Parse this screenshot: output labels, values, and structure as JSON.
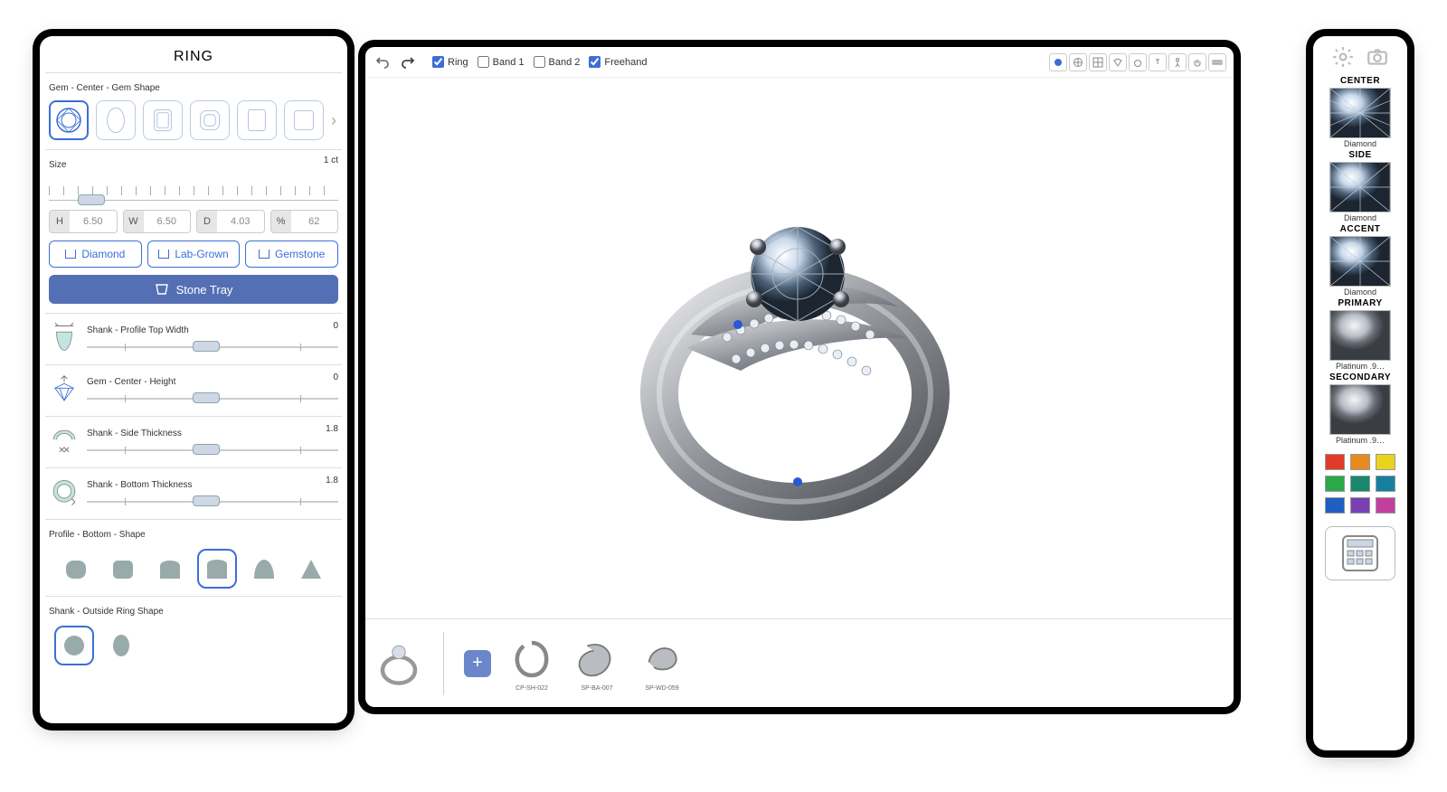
{
  "leftPanel": {
    "title": "RING",
    "gemShape": {
      "label": "Gem - Center - Gem Shape"
    },
    "size": {
      "label": "Size",
      "value": "1 ct"
    },
    "dims": {
      "h": {
        "label": "H",
        "value": "6.50"
      },
      "w": {
        "label": "W",
        "value": "6.50"
      },
      "d": {
        "label": "D",
        "value": "4.03"
      },
      "p": {
        "label": "%",
        "value": "62"
      }
    },
    "stoneButtons": {
      "diamond": "Diamond",
      "lab": "Lab-Grown",
      "gemstone": "Gemstone"
    },
    "stoneTray": "Stone Tray",
    "props": {
      "profileTop": {
        "label": "Shank - Profile Top Width",
        "value": "0"
      },
      "centerHeight": {
        "label": "Gem - Center - Height",
        "value": "0"
      },
      "sideThick": {
        "label": "Shank - Side Thickness",
        "value": "1.8"
      },
      "bottomThick": {
        "label": "Shank - Bottom Thickness",
        "value": "1.8"
      }
    },
    "profileBottom": {
      "label": "Profile - Bottom - Shape"
    },
    "outsideShape": {
      "label": "Shank - Outside Ring Shape"
    }
  },
  "toolbar": {
    "checks": {
      "ring": "Ring",
      "band1": "Band 1",
      "band2": "Band 2",
      "freehand": "Freehand"
    }
  },
  "tray": {
    "items": [
      {
        "id": "CP-SH-022"
      },
      {
        "id": "SP-BA-007"
      },
      {
        "id": "SP-WD-059"
      }
    ]
  },
  "rightPanel": {
    "groups": {
      "center": {
        "title": "CENTER",
        "caption": "Diamond"
      },
      "side": {
        "title": "SIDE",
        "caption": "Diamond"
      },
      "accent": {
        "title": "ACCENT",
        "caption": "Diamond"
      },
      "primary": {
        "title": "PRIMARY",
        "caption": "Platinum .9…"
      },
      "secondary": {
        "title": "SECONDARY",
        "caption": "Platinum .9…"
      }
    },
    "colors": [
      "#e03b2a",
      "#e88b1f",
      "#e8d31f",
      "#2aa84a",
      "#17886e",
      "#177f9e",
      "#1f5fc2",
      "#7a3fb3",
      "#c23f9e"
    ]
  }
}
